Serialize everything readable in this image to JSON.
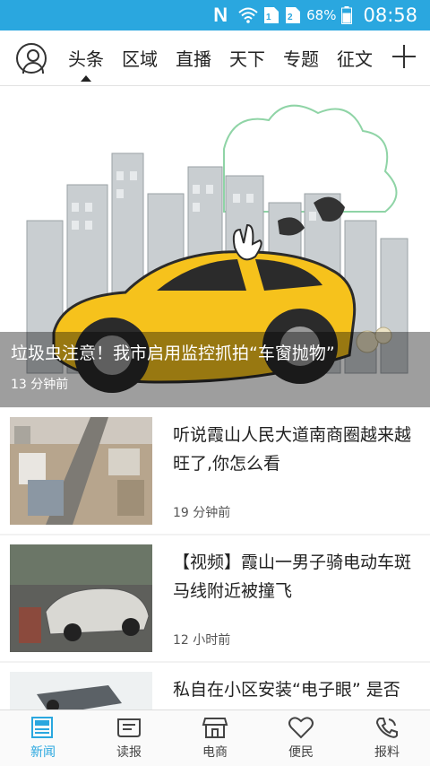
{
  "status": {
    "battery": "68%",
    "time": "08:58",
    "icons": [
      "n-notification-icon",
      "wifi-icon",
      "sim1-icon",
      "sim2-icon",
      "battery-icon"
    ]
  },
  "nav": {
    "tabs": [
      "头条",
      "区域",
      "直播",
      "天下",
      "专题",
      "征文"
    ],
    "active_tab": "头条",
    "add_icon": "plus-icon",
    "avatar_icon": "user-avatar-icon"
  },
  "hero": {
    "title": "垃圾虫注意！我市启用监控抓拍“车窗抛物”",
    "time": "13 分钟前"
  },
  "news": [
    {
      "title": "听说霞山人民大道南商圈越来越旺了,你怎么看",
      "time": "19 分钟前"
    },
    {
      "title": "【视频】霞山一男子骑电动车斑马线附近被撞飞",
      "time": "12 小时前"
    },
    {
      "title": "私自在小区安装“电子眼” 是否侵犯业主隐私权?",
      "time": ""
    }
  ],
  "bottom_tabs": [
    {
      "label": "新闻",
      "icon": "news-icon",
      "active": true
    },
    {
      "label": "读报",
      "icon": "newspaper-icon",
      "active": false
    },
    {
      "label": "电商",
      "icon": "shop-icon",
      "active": false
    },
    {
      "label": "便民",
      "icon": "heart-icon",
      "active": false
    },
    {
      "label": "报料",
      "icon": "phone-icon",
      "active": false
    }
  ],
  "colors": {
    "accent": "#2aa7df",
    "car": "#f6c21c"
  }
}
